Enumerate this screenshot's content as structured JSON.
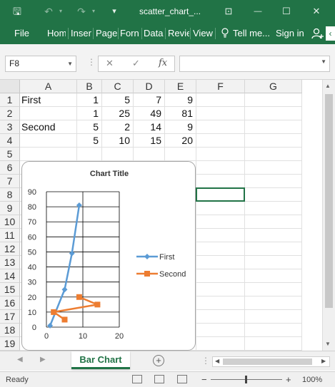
{
  "window": {
    "title": "scatter_chart_...",
    "buttons": {
      "save": "🖫",
      "undo": "↶",
      "redo": "↷",
      "qat_more": "▾",
      "ribbon_display": "⊡",
      "minimize": "—",
      "maximize": "☐",
      "close": "✕"
    }
  },
  "ribbon": {
    "tabs": [
      "File",
      "Hom",
      "Inser",
      "Page",
      "Forn",
      "Data",
      "Revie",
      "View"
    ],
    "tell_me": "Tell me...",
    "sign_in": "Sign in",
    "share_icon": "person-add-icon",
    "overflow": "‹"
  },
  "formula_bar": {
    "name_box": "F8",
    "cancel": "✕",
    "enter": "✓",
    "fx": "fx",
    "formula": ""
  },
  "columns": [
    "A",
    "B",
    "C",
    "D",
    "E",
    "F",
    "G"
  ],
  "rows": [
    "1",
    "2",
    "3",
    "4",
    "5",
    "6",
    "7",
    "8",
    "9",
    "10",
    "11",
    "12",
    "13",
    "14",
    "15",
    "16",
    "17",
    "18",
    "19"
  ],
  "cells": {
    "r1": {
      "A": "First",
      "B": "1",
      "C": "5",
      "D": "7",
      "E": "9"
    },
    "r2": {
      "A": "",
      "B": "1",
      "C": "25",
      "D": "49",
      "E": "81"
    },
    "r3": {
      "A": "Second",
      "B": "5",
      "C": "2",
      "D": "14",
      "E": "9"
    },
    "r4": {
      "A": "",
      "B": "5",
      "C": "10",
      "D": "15",
      "E": "20"
    }
  },
  "chart_data": {
    "type": "scatter",
    "title": "Chart Title",
    "xlim": [
      0,
      20
    ],
    "ylim": [
      0,
      90
    ],
    "x_ticks": [
      "0",
      "10",
      "20"
    ],
    "y_ticks": [
      "0",
      "10",
      "20",
      "30",
      "40",
      "50",
      "60",
      "70",
      "80",
      "90"
    ],
    "grid": true,
    "legend_position": "right",
    "series": [
      {
        "name": "First",
        "color": "#5b9bd5",
        "marker": "diamond",
        "points": [
          [
            1,
            1
          ],
          [
            5,
            25
          ],
          [
            7,
            49
          ],
          [
            9,
            81
          ]
        ]
      },
      {
        "name": "Second",
        "color": "#ed7d31",
        "marker": "square",
        "points": [
          [
            5,
            5
          ],
          [
            2,
            10
          ],
          [
            14,
            15
          ],
          [
            9,
            20
          ]
        ]
      }
    ]
  },
  "sheet_tabs": {
    "active": "Bar Chart",
    "add": "+"
  },
  "status_bar": {
    "ready": "Ready",
    "zoom_minus": "−",
    "zoom_plus": "+",
    "zoom_level": "100%"
  }
}
